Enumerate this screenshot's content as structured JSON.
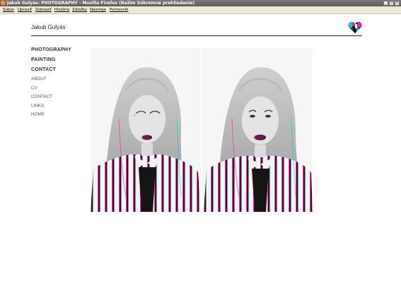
{
  "window": {
    "title": "Jakub Gulyás: PHOTOGRAPHY - Mozilla Firefox (Režim Súkromné prehliadanie)",
    "controls": [
      "_",
      "❐",
      "×"
    ]
  },
  "menubar": [
    "Súbor",
    "Upraviť",
    "Zobraziť",
    "História",
    "Záložky",
    "Nástroje",
    "Pomocník"
  ],
  "site": {
    "title": "Jakub Gulyás",
    "logo_icon": "heart-icon"
  },
  "nav": {
    "main": [
      "PHOTOGRAPHY",
      "PAINTING",
      "CONTACT"
    ],
    "sub": [
      "ABOUT",
      "CV",
      "CONTACT",
      "LINKS",
      "HOME"
    ]
  },
  "colors": {
    "titlebar": "#6b6b6b",
    "menubar": "#ece9d8",
    "accent_magenta": "#e0249a",
    "accent_cyan": "#19c4d8"
  }
}
